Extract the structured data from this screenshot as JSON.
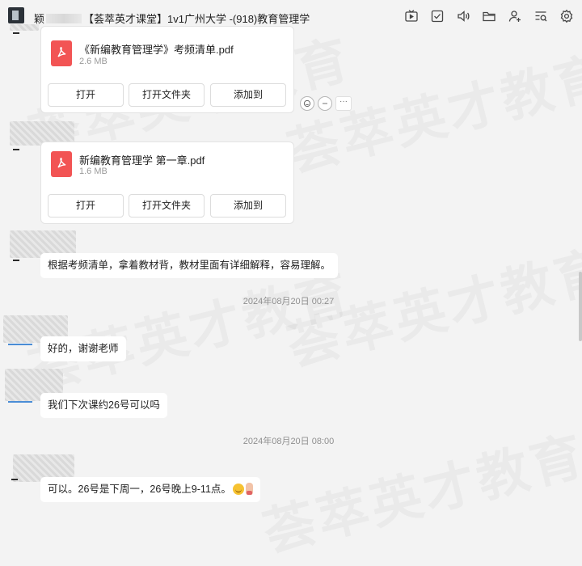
{
  "header": {
    "title_prefix": "颖",
    "title_main": "【荟萃英才课堂】1v1广州大学 -(918)教育管理学",
    "toolbar": [
      "tv-icon",
      "task-check-icon",
      "speaker-icon",
      "folder-icon",
      "add-user-icon",
      "history-search-icon",
      "settings-gear-icon"
    ]
  },
  "watermark_text": "荟萃英才教育",
  "messages": [
    {
      "type": "file",
      "file_name": "《新编教育管理学》考频清单.pdf",
      "file_size": "2.6 MB",
      "buttons": [
        "打开",
        "打开文件夹",
        "添加到"
      ]
    },
    {
      "type": "file",
      "file_name": "新编教育管理学  第一章.pdf",
      "file_size": "1.6 MB",
      "buttons": [
        "打开",
        "打开文件夹",
        "添加到"
      ]
    },
    {
      "type": "text",
      "text": "根据考频清单，拿着教材背，教材里面有详细解释，容易理解。"
    },
    {
      "type": "time",
      "text": "2024年08月20日  00:27"
    },
    {
      "type": "text",
      "text": "好的，谢谢老师"
    },
    {
      "type": "text",
      "text": "我们下次课约26号可以吗"
    },
    {
      "type": "time",
      "text": "2024年08月20日  08:00"
    },
    {
      "type": "text",
      "text": "可以。26号是下周一，26号晚上9-11点。"
    }
  ],
  "message_actions": [
    "emoji-add-icon",
    "reply-icon",
    "more-icon"
  ],
  "colors": {
    "pdf": "#f25454",
    "bg": "#f3f3f3",
    "accent": "#4a8dd6"
  }
}
